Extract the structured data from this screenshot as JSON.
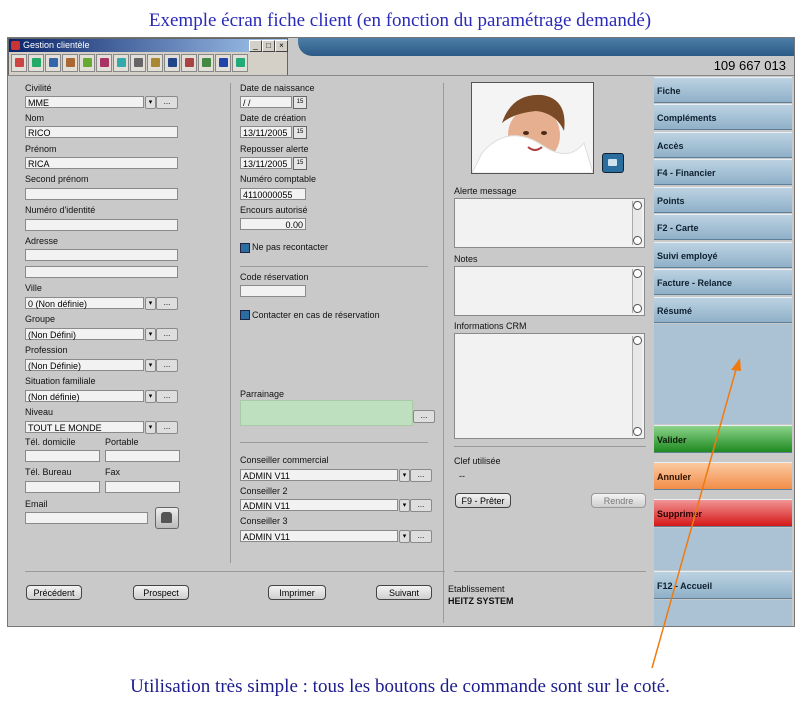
{
  "captions": {
    "top": "Exemple écran fiche client (en fonction du paramétrage demandé)",
    "bottom": "Utilisation très simple : tous les boutons de commande sont sur le coté."
  },
  "window": {
    "title": "Gestion clientèle",
    "minimize": "_",
    "maximize": "□",
    "close": "×",
    "phone": "109 667 013"
  },
  "toolbar_icons": [
    "folder-icon",
    "user-card-icon",
    "grid-icon",
    "calendar-icon",
    "chart-icon",
    "printer-icon",
    "document-icon",
    "table-icon",
    "list-icon",
    "save-icon",
    "report-icon",
    "stats-icon",
    "user-icon",
    "exit-icon"
  ],
  "col1": {
    "civilite_label": "Civilité",
    "civilite_value": "MME",
    "nom_label": "Nom",
    "nom_value": "RICO",
    "prenom_label": "Prénom",
    "prenom_value": "RICA",
    "second_prenom_label": "Second prénom",
    "numero_identite_label": "Numéro d'identité",
    "adresse_label": "Adresse",
    "ville_label": "Ville",
    "ville_value": "0 (Non définie)",
    "groupe_label": "Groupe",
    "groupe_value": "(Non Défini)",
    "profession_label": "Profession",
    "profession_value": "(Non Définie)",
    "situation_label": "Situation familiale",
    "situation_value": "(Non définie)",
    "niveau_label": "Niveau",
    "niveau_value": "TOUT LE MONDE",
    "tel_domicile_label": "Tél. domicile",
    "portable_label": "Portable",
    "tel_bureau_label": "Tél. Bureau",
    "fax_label": "Fax",
    "email_label": "Email",
    "ellipsis": "...",
    "arrow": "▾"
  },
  "col2": {
    "naissance_label": "Date de naissance",
    "naissance_value": " / /",
    "creation_label": "Date de création",
    "creation_value": "13/11/2005",
    "repousser_label": "Repousser alerte",
    "repousser_value": "13/11/2005",
    "numero_comptable_label": "Numéro comptable",
    "numero_comptable_value": "4110000055",
    "encours_label": "Encours autorisé",
    "encours_value": "0.00",
    "ne_pas_recontacter": "Ne pas recontacter",
    "code_reservation_label": "Code réservation",
    "contacter_label": "Contacter en cas de réservation",
    "parrainage_label": "Parrainage",
    "conseiller_commercial_label": "Conseiller commercial",
    "conseiller_commercial_value": "ADMIN V11",
    "conseiller2_label": "Conseiller 2",
    "conseiller2_value": "ADMIN V11",
    "conseiller3_label": "Conseiller 3",
    "conseiller3_value": "ADMIN V11",
    "cal_glyph": "15"
  },
  "col3": {
    "alerte_label": "Alerte message",
    "notes_label": "Notes",
    "crm_label": "Informations CRM",
    "clef_label": "Clef utilisée",
    "clef_value": "--",
    "preter_button": "F9 - Prêter",
    "rendre_button": "Rendre",
    "etablissement_label": "Etablissement",
    "etablissement_value": "HEITZ SYSTEM"
  },
  "bottom_buttons": {
    "precedent": "Précédent",
    "prospect": "Prospect",
    "imprimer": "Imprimer",
    "suivant": "Suivant"
  },
  "sidebar": {
    "items": [
      "Fiche",
      "Compléments",
      "Accès",
      "F4 - Financier",
      "Points",
      "F2 - Carte",
      "Suivi employé",
      "Facture - Relance",
      "Résumé"
    ],
    "valider": "Valider",
    "annuler": "Annuler",
    "supprimer": "Supprimer",
    "accueil": "F12 - Accueil"
  },
  "colors": {
    "sidebar_blue": "#8fb0c8",
    "valider_green": "#1f8a1f",
    "annuler_orange": "#f28d49",
    "supprimer_red": "#d51818",
    "parrainage_green": "#bfe0bf",
    "arrow_orange": "#f07a10"
  }
}
